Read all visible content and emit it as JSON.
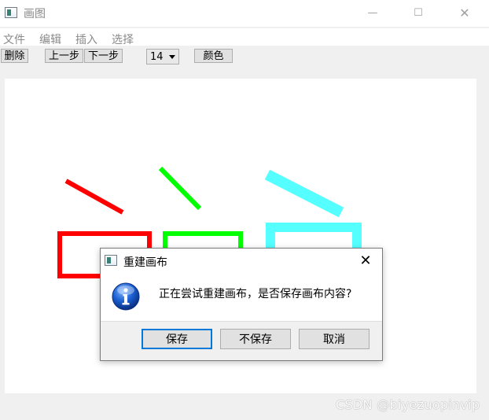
{
  "window": {
    "title": "画图",
    "minimize_glyph": "—",
    "maximize_glyph": "☐",
    "close_glyph": "✕"
  },
  "menu": {
    "items": [
      {
        "label": "文件"
      },
      {
        "label": "编辑"
      },
      {
        "label": "插入"
      },
      {
        "label": "选择"
      }
    ]
  },
  "toolbar": {
    "delete_label": "删除",
    "undo_label": "上一步",
    "redo_label": "下一步",
    "font_size_value": "14",
    "color_label": "颜色"
  },
  "canvas": {
    "strokes": [
      {
        "shape": "line",
        "color": "#ff0000"
      },
      {
        "shape": "line",
        "color": "#00ff00"
      },
      {
        "shape": "line",
        "color": "#55ffff"
      },
      {
        "shape": "rect",
        "color": "#ff0000"
      },
      {
        "shape": "rect",
        "color": "#00ff00"
      },
      {
        "shape": "rect",
        "color": "#55ffff"
      }
    ]
  },
  "dialog": {
    "title": "重建画布",
    "icon": "info-icon",
    "message": "正在尝试重建画布，是否保存画布内容?",
    "save_label": "保存",
    "dont_save_label": "不保存",
    "cancel_label": "取消",
    "close_glyph": "✕"
  },
  "watermark": {
    "text": "CSDN @biyezuopinvip"
  },
  "colors": {
    "accent": "#0078d7",
    "red": "#ff0000",
    "green": "#00ff00",
    "cyan": "#55ffff"
  }
}
